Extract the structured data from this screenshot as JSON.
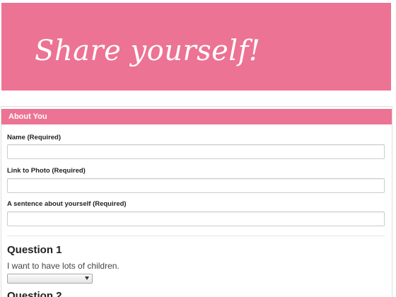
{
  "hero": {
    "title": "Share yourself!"
  },
  "section": {
    "header": "About You"
  },
  "fields": {
    "name": {
      "label": "Name (Required)",
      "value": "",
      "placeholder": ""
    },
    "photo_link": {
      "label": "Link to Photo (Required)",
      "value": "",
      "placeholder": ""
    },
    "about": {
      "label": "A sentence about yourself (Required)",
      "value": "",
      "placeholder": ""
    }
  },
  "questions": [
    {
      "heading": "Question 1",
      "text": "I want to have lots of children.",
      "selected": ""
    },
    {
      "heading": "Question 2"
    }
  ],
  "icons": {
    "select_arrow": "caret-down-icon"
  },
  "colors": {
    "accent": "#ec7393",
    "header_text": "#ffffff"
  }
}
